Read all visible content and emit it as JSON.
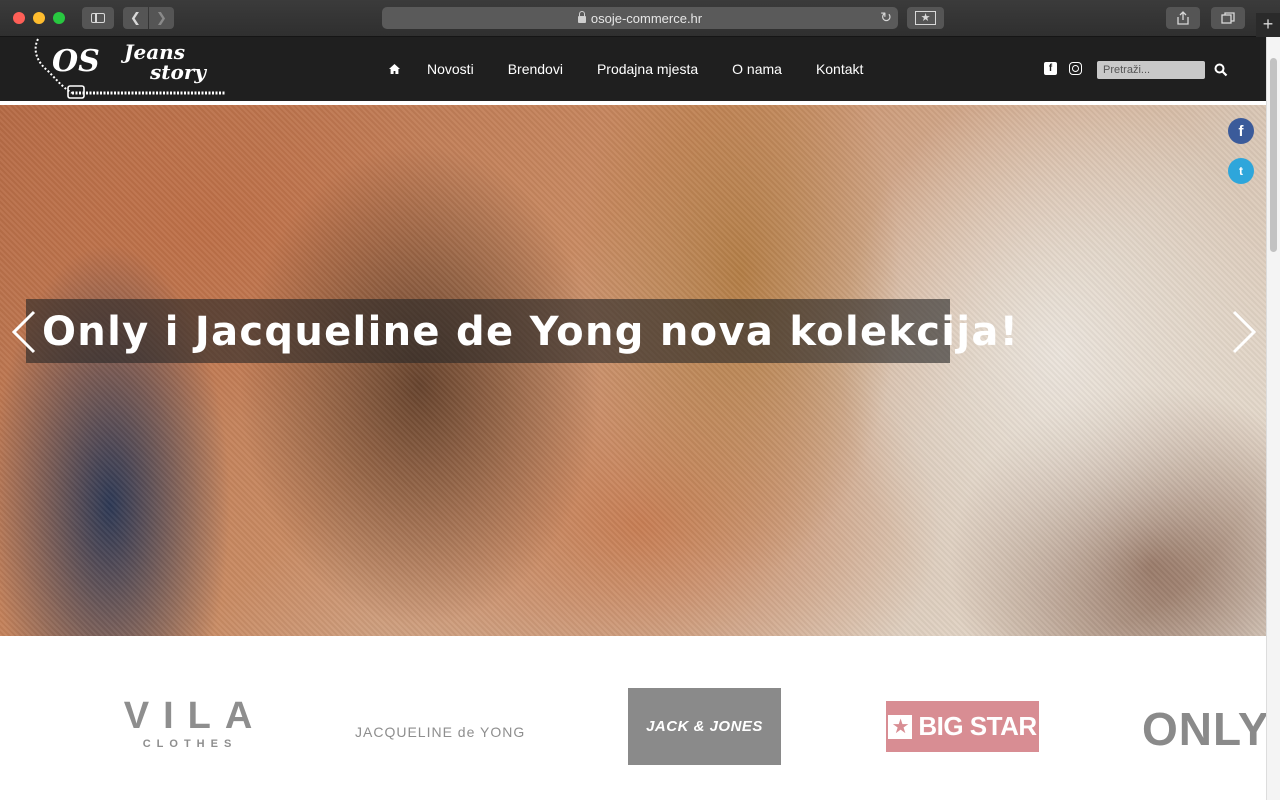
{
  "browser": {
    "url": "osoje-commerce.hr"
  },
  "site": {
    "logo_line1": "OS Jeans",
    "logo_line2": "story",
    "nav": [
      "Novosti",
      "Brendovi",
      "Prodajna mjesta",
      "O nama",
      "Kontakt"
    ],
    "search_placeholder": "Pretraži...",
    "social_icons": [
      "facebook-icon",
      "instagram-icon"
    ]
  },
  "hero": {
    "caption": "Only i Jacqueline de Yong nova kolekcija!",
    "share": [
      "f",
      "t"
    ]
  },
  "brands": {
    "vila_main": "VILA",
    "vila_sub": "CLOTHES",
    "jdy": "JACQUELINE de YONG",
    "jack_jones": "JACK & JONES",
    "bigstar": "BIG STAR",
    "only": "ONLY"
  },
  "colors": {
    "header_bg": "#1f1f1f",
    "facebook": "#3b5b9a",
    "twitter": "#2ea6db",
    "bigstar_pink": "#d88d93",
    "jackjones_gray": "#8a8a8a"
  }
}
